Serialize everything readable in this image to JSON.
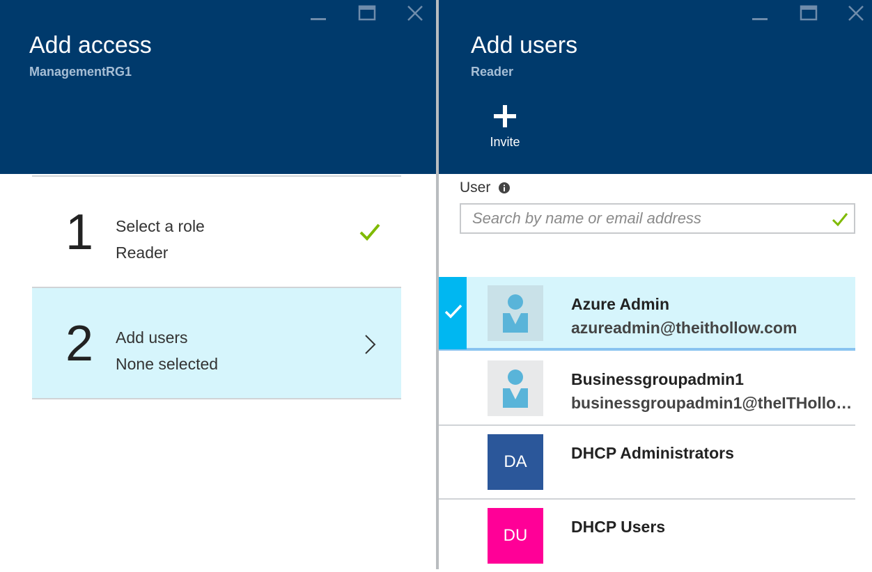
{
  "left_blade": {
    "title": "Add access",
    "subtitle": "ManagementRG1",
    "steps": [
      {
        "number": "1",
        "label": "Select a role",
        "value": "Reader",
        "status": "complete"
      },
      {
        "number": "2",
        "label": "Add users",
        "value": "None selected",
        "status": "active"
      }
    ]
  },
  "right_blade": {
    "title": "Add users",
    "subtitle": "Reader",
    "invite_label": "Invite",
    "user_field": {
      "label": "User",
      "placeholder": "Search by name or email address"
    },
    "users": [
      {
        "name": "Azure Admin",
        "email": "azureadmin@theithollow.com",
        "avatar": "person-icon",
        "selected": true
      },
      {
        "name": "Businessgroupadmin1",
        "email": "businessgroupadmin1@theITHollow...",
        "avatar": "person-icon",
        "selected": false
      },
      {
        "name": "DHCP Administrators",
        "email": "",
        "initials": "DA",
        "color": "#2b579a",
        "selected": false
      },
      {
        "name": "DHCP Users",
        "email": "",
        "initials": "DU",
        "color": "#ff0097",
        "selected": false
      }
    ]
  },
  "colors": {
    "header": "#003a6c",
    "selected_bg": "#d6f5fc",
    "accent": "#00b7f1",
    "check_green": "#7fba00"
  }
}
